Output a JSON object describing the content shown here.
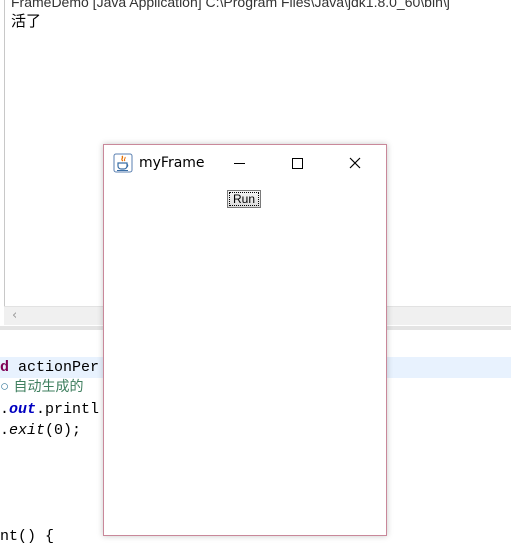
{
  "console": {
    "header": "FrameDemo [Java Application] C:\\Program Files\\Java\\jdk1.8.0_60\\bin\\j",
    "output_line": "活了"
  },
  "editor": {
    "line1_kw": "d",
    "line1_rest": " actionPer",
    "line2_marker": "○",
    "line2_comment": " 自动生成的",
    "line3_dot": ".",
    "line3_field": "out",
    "line3_rest": ".printl",
    "line4_dot": ".",
    "line4_method": "exit",
    "line4_rest": "(0);",
    "line5_text": "nt() {"
  },
  "window": {
    "title": "myFrame",
    "run_button_label": "Run",
    "icon": "java-icon"
  },
  "colors": {
    "window_border": "#c9889a",
    "keyword": "#7f0055",
    "static_field": "#0000c0",
    "comment": "#3f7f5f",
    "highlight_line": "#e8f2fe"
  }
}
